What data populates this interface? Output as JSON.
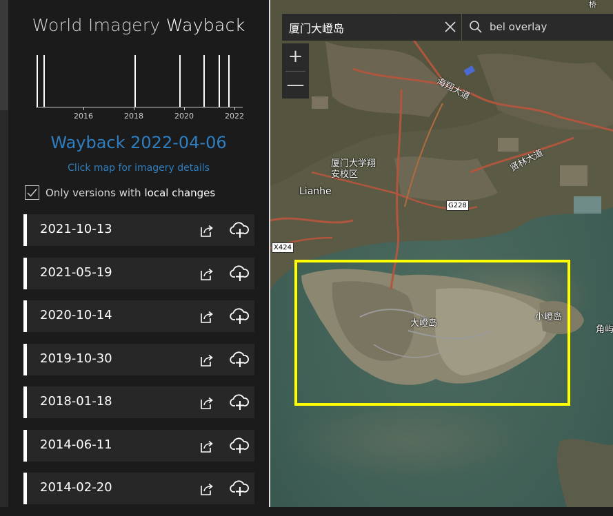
{
  "app": {
    "title_prefix": "World Imagery",
    "title_strong": "Wayback"
  },
  "timeline": {
    "year_labels": [
      "2016",
      "2018",
      "2020",
      "2022"
    ]
  },
  "current_release": {
    "title": "Wayback 2022-04-06",
    "hint": "Click map for imagery details"
  },
  "filter": {
    "checked": true,
    "label_prefix": "Only versions with",
    "label_strong": "local changes"
  },
  "versions": [
    {
      "date": "2021-10-13"
    },
    {
      "date": "2021-05-19"
    },
    {
      "date": "2020-10-14"
    },
    {
      "date": "2019-10-30"
    },
    {
      "date": "2018-01-18"
    },
    {
      "date": "2014-06-11"
    },
    {
      "date": "2014-02-20"
    }
  ],
  "search": {
    "value": "厦门大嶝岛",
    "suggestion": "bel overlay"
  },
  "zoom": {
    "in_label": "+",
    "out_label": "—"
  },
  "map_labels": {
    "road1": "海翔大道",
    "road2": "贤林大道",
    "campus": "厦门大学翔安校区",
    "lianhe": "Lianhe",
    "island_big": "大嶝岛",
    "island_small": "小嶝岛",
    "edge_right": "角屿",
    "edge_top": "桥"
  },
  "road_signs": {
    "g228": "G228",
    "x424": "X424"
  },
  "colors": {
    "accent": "#2f7fc0",
    "selection": "#ffff00",
    "panel_bg": "#1b1b1b"
  }
}
